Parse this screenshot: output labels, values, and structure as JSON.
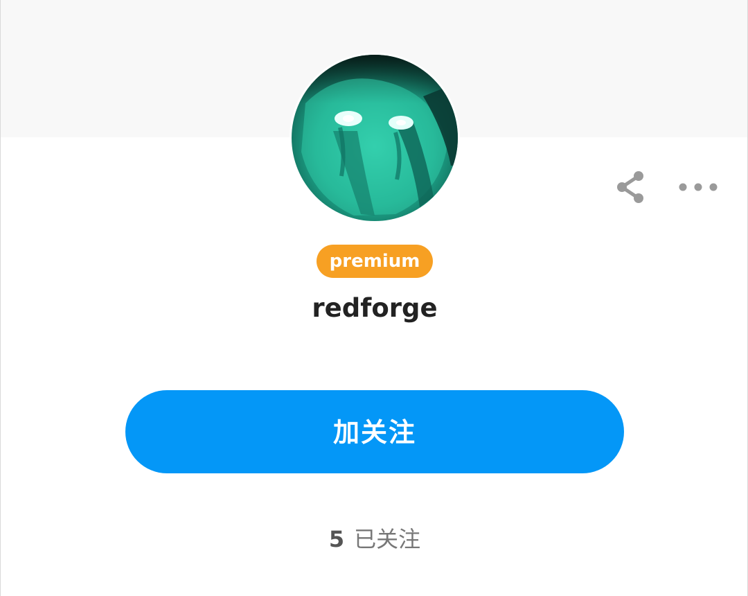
{
  "profile": {
    "badge": "premium",
    "username": "redforge",
    "follow_label": "加关注",
    "following_count": "5",
    "following_label": "已关注"
  },
  "actions": {
    "share_icon": "share-icon",
    "more_icon": "more-horizontal-icon"
  },
  "colors": {
    "accent": "#0497f7",
    "badge": "#f7a023",
    "cover": "#f8f8f8",
    "icon": "#9a9a9a"
  }
}
